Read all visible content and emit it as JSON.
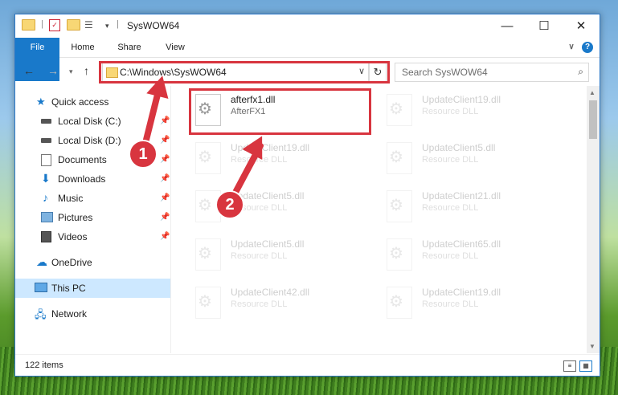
{
  "window": {
    "title": "SysWOW64"
  },
  "ribbon": {
    "tabs": [
      "File",
      "Home",
      "Share",
      "View"
    ]
  },
  "address": {
    "path": "C:\\Windows\\SysWOW64"
  },
  "search": {
    "placeholder": "Search SysWOW64"
  },
  "sidebar": {
    "items": [
      {
        "label": "Quick access",
        "icon": "star-icon"
      },
      {
        "label": "Local Disk (C:)",
        "icon": "drive-icon"
      },
      {
        "label": "Local Disk (D:)",
        "icon": "drive-icon"
      },
      {
        "label": "Documents",
        "icon": "documents-icon"
      },
      {
        "label": "Downloads",
        "icon": "download-icon"
      },
      {
        "label": "Music",
        "icon": "music-icon"
      },
      {
        "label": "Pictures",
        "icon": "pictures-icon"
      },
      {
        "label": "Videos",
        "icon": "videos-icon"
      },
      {
        "label": "OneDrive",
        "icon": "cloud-icon"
      },
      {
        "label": "This PC",
        "icon": "computer-icon"
      },
      {
        "label": "Network",
        "icon": "network-icon"
      }
    ]
  },
  "files": [
    {
      "name": "afterfx1.dll",
      "desc": "AfterFX1"
    },
    {
      "name": "UpdateClient19.dll",
      "desc": "Resource DLL"
    },
    {
      "name": "UpdateClient19.dll",
      "desc": "Resource DLL"
    },
    {
      "name": "UpdateClient5.dll",
      "desc": "Resource DLL"
    },
    {
      "name": "UpdateClient5.dll",
      "desc": "Resource DLL"
    },
    {
      "name": "UpdateClient21.dll",
      "desc": "Resource DLL"
    },
    {
      "name": "UpdateClient5.dll",
      "desc": "Resource DLL"
    },
    {
      "name": "UpdateClient65.dll",
      "desc": "Resource DLL"
    },
    {
      "name": "UpdateClient42.dll",
      "desc": "Resource DLL"
    },
    {
      "name": "UpdateClient19.dll",
      "desc": "Resource DLL"
    }
  ],
  "status": {
    "count": "122 items"
  },
  "annotations": {
    "badge1": "1",
    "badge2": "2"
  },
  "colors": {
    "accent": "#1979ca",
    "highlight": "#d8353f",
    "selected": "#cde8ff"
  }
}
